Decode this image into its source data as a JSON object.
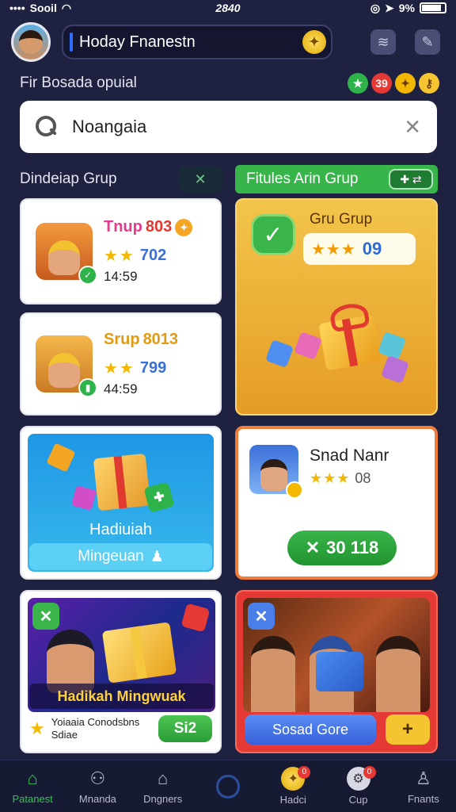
{
  "status_bar": {
    "carrier": "Sooil",
    "time": "2840",
    "battery": "9%"
  },
  "header": {
    "title": "Hoday Fnanestn",
    "coin_icon": "star-coin-icon",
    "menu_icons": [
      "layers-icon",
      "edit-icon"
    ]
  },
  "subheader": {
    "label": "Fir Bosada opuial",
    "badges": [
      "",
      "39",
      "",
      ""
    ]
  },
  "search": {
    "value": "Noangaia",
    "placeholder": ""
  },
  "left_section": {
    "label": "Dindeiap Grup",
    "control": "✕"
  },
  "right_section": {
    "label": "Fitules Arin Grup",
    "control": "✚ ⇄"
  },
  "group_cards": [
    {
      "title": "Tnup",
      "number": "803",
      "rating": "702",
      "time": "14:59"
    },
    {
      "title": "Srup",
      "number": "8013",
      "rating": "799",
      "time": "44:59"
    }
  ],
  "featured_card": {
    "name": "Gru Grup",
    "rating": "09"
  },
  "reward_card": {
    "line1": "Hadiuiah",
    "line2": "Mingeuan"
  },
  "player_card": {
    "name": "Snad Nanr",
    "rating": "08",
    "button": "30 118"
  },
  "promo_card": {
    "banner": "Hadikah Mingwuak",
    "text": "Yoiaaia Conodsbns Sdiae",
    "button": "Si2"
  },
  "red_card": {
    "button": "Sosad Gore",
    "plus": "+"
  },
  "bottom_nav": [
    {
      "label": "Patanest",
      "active": true
    },
    {
      "label": "Mnanda",
      "active": false
    },
    {
      "label": "Dngners",
      "active": false
    },
    {
      "label": "",
      "active": false
    },
    {
      "label": "Hadci",
      "active": false,
      "badge": "0"
    },
    {
      "label": "Cup",
      "active": false,
      "badge": "0"
    },
    {
      "label": "Fnants",
      "active": false
    }
  ],
  "colors": {
    "background": "#1e2140",
    "accent_green": "#38b54a",
    "accent_gold": "#f3c54b",
    "accent_red": "#e53935"
  }
}
